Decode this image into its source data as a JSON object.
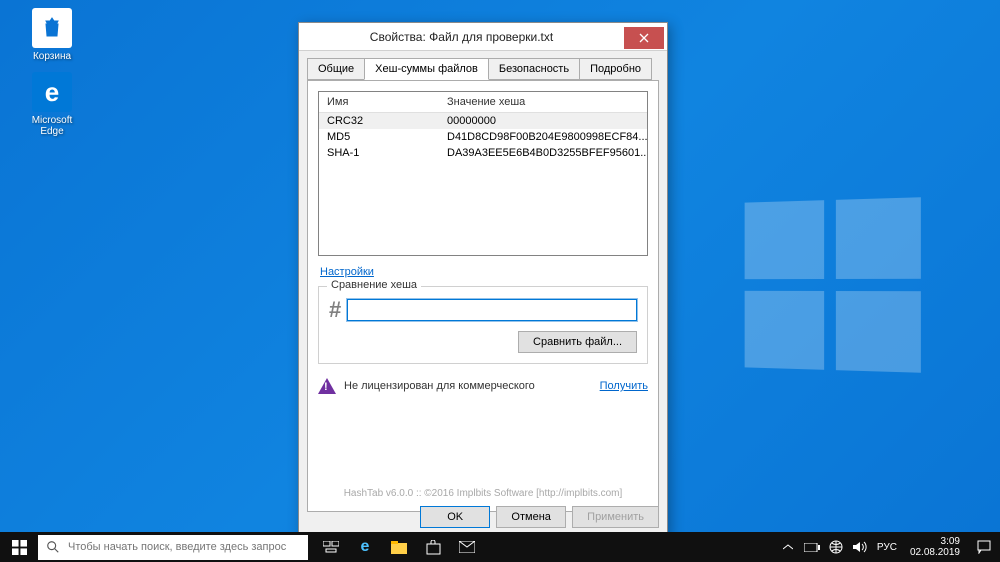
{
  "desktop": {
    "icons": [
      {
        "label": "Корзина"
      },
      {
        "label": "Microsoft Edge"
      }
    ]
  },
  "dialog": {
    "title": "Свойства: Файл для проверки.txt",
    "tabs": [
      "Общие",
      "Хеш-суммы файлов",
      "Безопасность",
      "Подробно"
    ],
    "active_tab": 1,
    "grid": {
      "head_name": "Имя",
      "head_value": "Значение хеша",
      "rows": [
        {
          "name": "CRC32",
          "value": "00000000"
        },
        {
          "name": "MD5",
          "value": "D41D8CD98F00B204E9800998ECF84..."
        },
        {
          "name": "SHA-1",
          "value": "DA39A3EE5E6B4B0D3255BFEF95601..."
        }
      ]
    },
    "settings_link": "Настройки",
    "compare": {
      "legend": "Сравнение хеша",
      "value": "",
      "button": "Сравнить файл..."
    },
    "alert": {
      "text": "Не лицензирован для коммерческого",
      "link": "Получить"
    },
    "footer": "HashTab v6.0.0 :: ©2016 Implbits Software [http://implbits.com]",
    "buttons": {
      "ok": "OK",
      "cancel": "Отмена",
      "apply": "Применить"
    }
  },
  "taskbar": {
    "search_placeholder": "Чтобы начать поиск, введите здесь запрос",
    "lang": "РУС",
    "time": "3:09",
    "date": "02.08.2019"
  }
}
